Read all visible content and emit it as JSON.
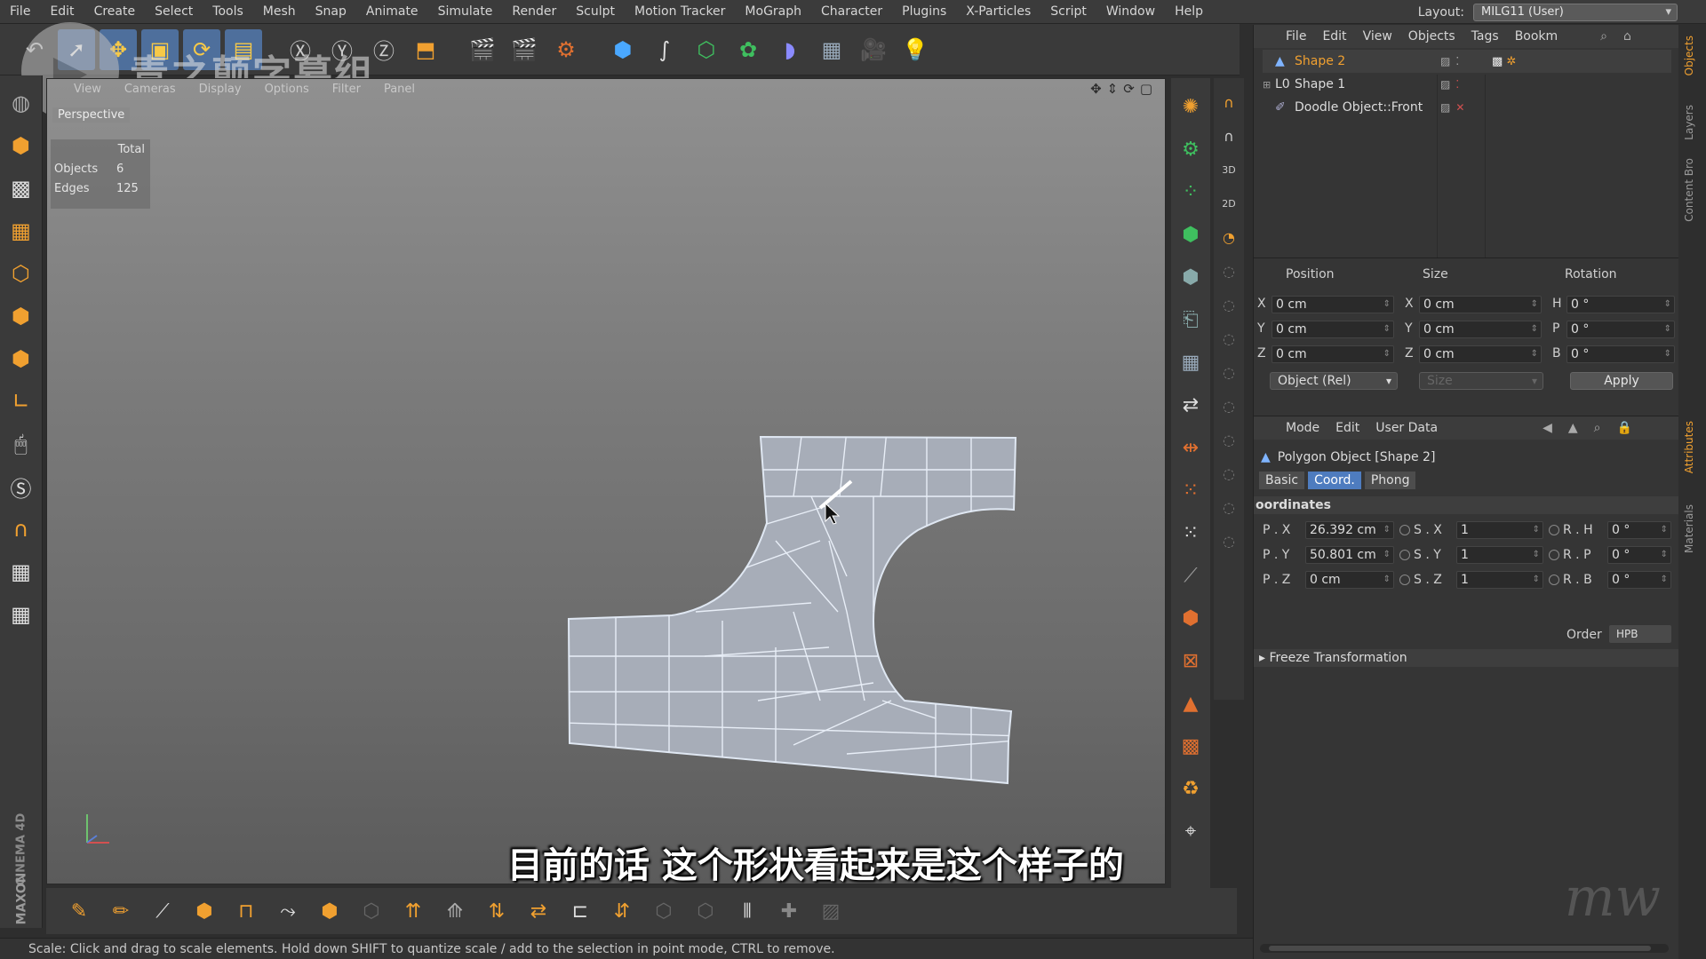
{
  "menu": [
    "File",
    "Edit",
    "Create",
    "Select",
    "Tools",
    "Mesh",
    "Snap",
    "Animate",
    "Simulate",
    "Render",
    "Sculpt",
    "Motion Tracker",
    "MoGraph",
    "Character",
    "Plugins",
    "X-Particles",
    "Script",
    "Window",
    "Help"
  ],
  "layout": {
    "label": "Layout:",
    "value": "MILG11 (User)"
  },
  "watermark": {
    "text": "青之颠字幕组"
  },
  "viewport": {
    "menu": [
      "View",
      "Cameras",
      "Display",
      "Options",
      "Filter",
      "Panel"
    ],
    "camera": "Perspective",
    "stats": {
      "header": "Total",
      "rows": [
        {
          "label": "Objects",
          "value": "6"
        },
        {
          "label": "Edges",
          "value": "125"
        }
      ]
    },
    "subtitle": "目前的话 这个形状看起来是这个样子的"
  },
  "brand": {
    "maxon": "MAXON",
    "cinema": "CINEMA 4D"
  },
  "status": "Scale: Click and drag to scale elements. Hold down SHIFT to quantize scale / add to the selection in point mode, CTRL to remove.",
  "objects_menu": [
    "File",
    "Edit",
    "View",
    "Objects",
    "Tags",
    "Bookm"
  ],
  "objects": [
    {
      "name": "Shape 2",
      "icon": "polygon-icon",
      "selected": true
    },
    {
      "name": "Shape 1",
      "icon": "null-icon",
      "selected": false
    },
    {
      "name": "Doodle Object::Front",
      "icon": "doodle-icon",
      "selected": false
    }
  ],
  "coord": {
    "headers": [
      "Position",
      "Size",
      "Rotation"
    ],
    "position": [
      {
        "axis": "X",
        "value": "0 cm"
      },
      {
        "axis": "Y",
        "value": "0 cm"
      },
      {
        "axis": "Z",
        "value": "0 cm"
      }
    ],
    "size": [
      {
        "axis": "X",
        "value": "0 cm"
      },
      {
        "axis": "Y",
        "value": "0 cm"
      },
      {
        "axis": "Z",
        "value": "0 cm"
      }
    ],
    "rotation": [
      {
        "axis": "H",
        "value": "0 °"
      },
      {
        "axis": "P",
        "value": "0 °"
      },
      {
        "axis": "B",
        "value": "0 °"
      }
    ],
    "mode": "Object (Rel)",
    "size_mode": "Size",
    "apply": "Apply"
  },
  "attributes": {
    "menu": [
      "Mode",
      "Edit",
      "User Data"
    ],
    "title": "Polygon Object [Shape 2]",
    "tabs": [
      "Basic",
      "Coord.",
      "Phong"
    ],
    "active_tab": "Coord.",
    "section": "oordinates",
    "rows": [
      {
        "p_label": "P . X",
        "p_value": "26.392 cm",
        "s_label": "S . X",
        "s_value": "1",
        "r_label": "R . H",
        "r_value": "0 °"
      },
      {
        "p_label": "P . Y",
        "p_value": "50.801 cm",
        "s_label": "S . Y",
        "s_value": "1",
        "r_label": "R . P",
        "r_value": "0 °"
      },
      {
        "p_label": "P . Z",
        "p_value": "0 cm",
        "s_label": "S . Z",
        "s_value": "1",
        "r_label": "R . B",
        "r_value": "0 °"
      }
    ],
    "order_label": "Order",
    "order_value": "HPB",
    "freeze": "Freeze Transformation"
  },
  "side_tabs": [
    "Objects",
    "Layers",
    "Content Bro",
    "Attributes",
    "Materials"
  ],
  "colors": {
    "accent": "#f0a030",
    "selection": "#4e7cbf"
  }
}
